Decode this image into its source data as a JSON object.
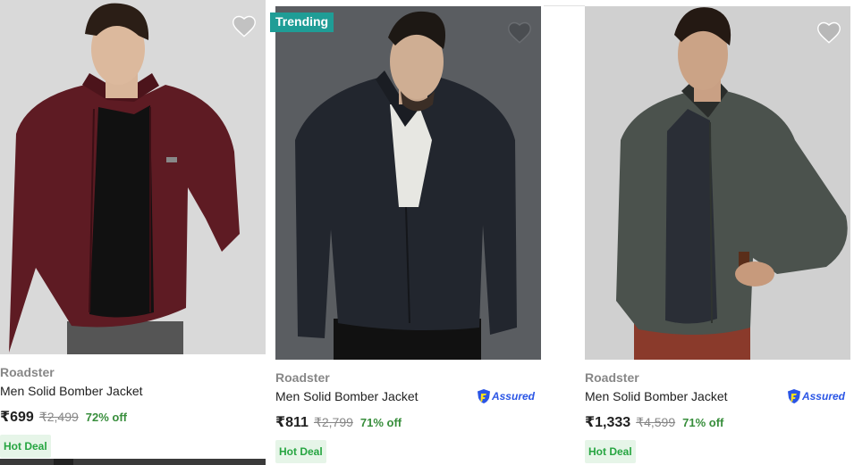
{
  "products": [
    {
      "brand": "Roadster",
      "title": "Men Solid Bomber Jacket",
      "price": "₹699",
      "mrp": "₹2,499",
      "discount": "72% off",
      "deal": "Hot Deal",
      "assured": false,
      "jacket_color": "#5e1b23",
      "bg_color": "#d8d8d8"
    },
    {
      "brand": "Roadster",
      "title": "Men Solid Bomber Jacket",
      "price": "₹811",
      "mrp": "₹2,799",
      "discount": "71% off",
      "deal": "Hot Deal",
      "assured": true,
      "assured_label": "Assured",
      "badge": "Trending",
      "jacket_color": "#23272f",
      "bg_color": "#5b5e62"
    },
    {
      "brand": "Roadster",
      "title": "Men Solid Bomber Jacket",
      "price": "₹1,333",
      "mrp": "₹4,599",
      "discount": "71% off",
      "deal": "Hot Deal",
      "assured": true,
      "assured_label": "Assured",
      "jacket_color": "#47504a",
      "bg_color": "#cfcfcf"
    }
  ],
  "icons": {
    "wishlist": "heart-icon",
    "assured": "flipkart-assured-icon"
  },
  "colors": {
    "accent": "#2874f0",
    "discount": "#388e3c",
    "deal_bg": "#e6f5e8",
    "deal_text": "#26a541",
    "trending_bg": "#1f9d96"
  }
}
